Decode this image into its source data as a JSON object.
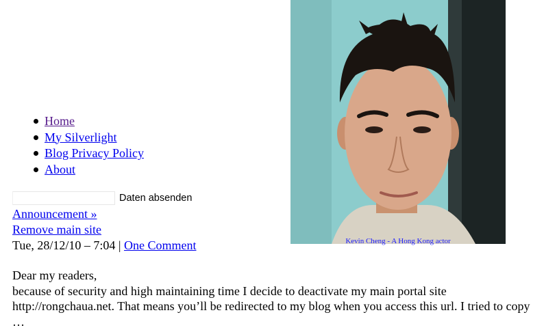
{
  "nav": {
    "items": [
      {
        "label": "Home",
        "visited": true
      },
      {
        "label": "My Silverlight",
        "visited": false
      },
      {
        "label": "Blog Privacy Policy",
        "visited": false
      },
      {
        "label": "About",
        "visited": false
      }
    ]
  },
  "search": {
    "value": "",
    "submit_label": "Daten absenden"
  },
  "post": {
    "category_link": "Announcement »",
    "title": "Remove main site",
    "date": "Tue, 28/12/10 – 7:04",
    "separator": " | ",
    "comments_link": "One Comment",
    "excerpt": [
      "Dear my readers,",
      "because of security and high maintaining time I decide to deactivate my main portal site",
      "http://rongchaua.net. That means you’ll be redirected to my blog when you access this url. I tried to copy",
      "…"
    ]
  },
  "image": {
    "caption": "Kevin Cheng - A Hong Kong actor",
    "colors": {
      "background": "#8ccccc",
      "skin": "#d9a78a",
      "hair": "#1a1410",
      "caption": "#1a1aff"
    }
  }
}
